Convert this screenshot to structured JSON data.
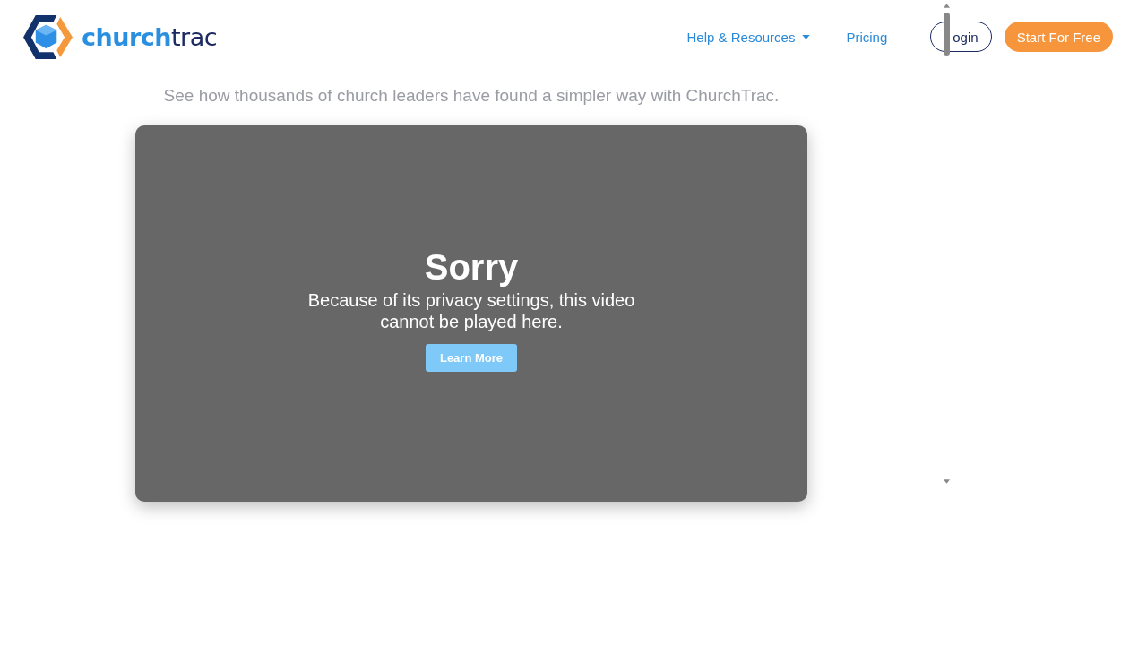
{
  "header": {
    "logo_text": "**church**trac",
    "nav": [
      {
        "label": "Help & Resources",
        "kind": "dropdown"
      },
      {
        "label": "Pricing",
        "kind": "link"
      }
    ],
    "login_button": "ogin",
    "cta_button": "Start For Free"
  },
  "subtitle": "See how thousands of church leaders have found a simpler way with ChurchTrac.",
  "video": {
    "title": "Sorry",
    "message": "Because of its privacy settings, this video cannot be played here.",
    "button": "Learn More"
  }
}
